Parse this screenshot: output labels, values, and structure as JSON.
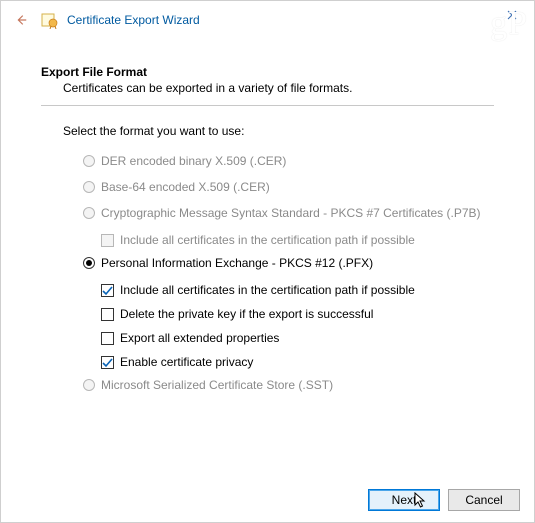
{
  "window": {
    "title": "Certificate Export Wizard",
    "watermark": "gP"
  },
  "heading": {
    "title": "Export File Format",
    "desc": "Certificates can be exported in a variety of file formats."
  },
  "prompt": "Select the format you want to use:",
  "options": {
    "der": {
      "label": "DER encoded binary X.509 (.CER)"
    },
    "base64": {
      "label": "Base-64 encoded X.509 (.CER)"
    },
    "p7b": {
      "label": "Cryptographic Message Syntax Standard - PKCS #7 Certificates (.P7B)",
      "include_chain": "Include all certificates in the certification path if possible"
    },
    "pfx": {
      "label": "Personal Information Exchange - PKCS #12 (.PFX)",
      "include_chain": "Include all certificates in the certification path if possible",
      "delete_key": "Delete the private key if the export is successful",
      "export_ext": "Export all extended properties",
      "cert_privacy": "Enable certificate privacy"
    },
    "sst": {
      "label": "Microsoft Serialized Certificate Store (.SST)"
    }
  },
  "buttons": {
    "next": "Next",
    "cancel": "Cancel"
  }
}
